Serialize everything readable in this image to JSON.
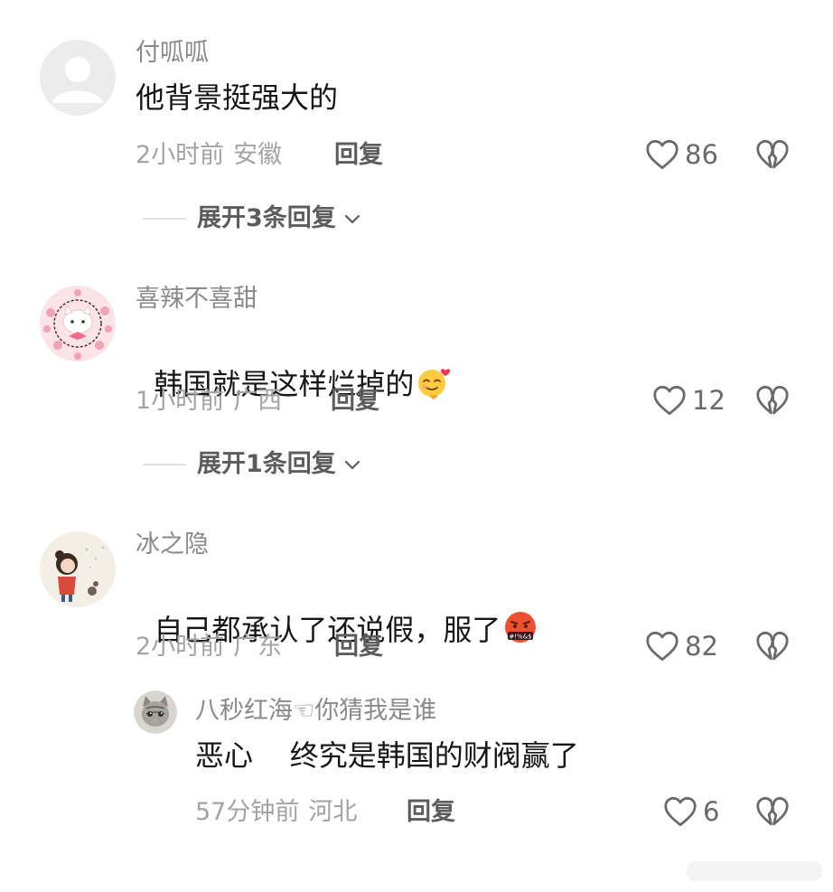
{
  "comments": [
    {
      "username": "付呱呱",
      "content": "他背景挺强大的",
      "time": "2小时前",
      "location": "安徽",
      "reply_label": "回复",
      "likes": "86",
      "expand_label": "展开3条回复"
    },
    {
      "username": "喜辣不喜甜",
      "content": "韩国就是这样烂掉的",
      "emoji": "smiling-face-with-hearts-emoji",
      "time": "1小时前",
      "location": "广西",
      "reply_label": "回复",
      "likes": "12",
      "expand_label": "展开1条回复"
    },
    {
      "username": "冰之隐",
      "content": "自己都承认了还说假，服了",
      "emoji": "face-with-symbols-on-mouth-emoji",
      "time": "2小时前",
      "location": "广东",
      "reply_label": "回复",
      "likes": "82"
    }
  ],
  "reply": {
    "username": "八秒红海☜你猜我是谁",
    "content": "恶心    终究是韩国的财阀赢了",
    "time": "57分钟前",
    "location": "河北",
    "reply_label": "回复",
    "likes": "6"
  },
  "colors": {
    "username": "#8a8a8a",
    "meta": "#a3a3a3",
    "action": "#5c5c5c",
    "text": "#161616"
  }
}
